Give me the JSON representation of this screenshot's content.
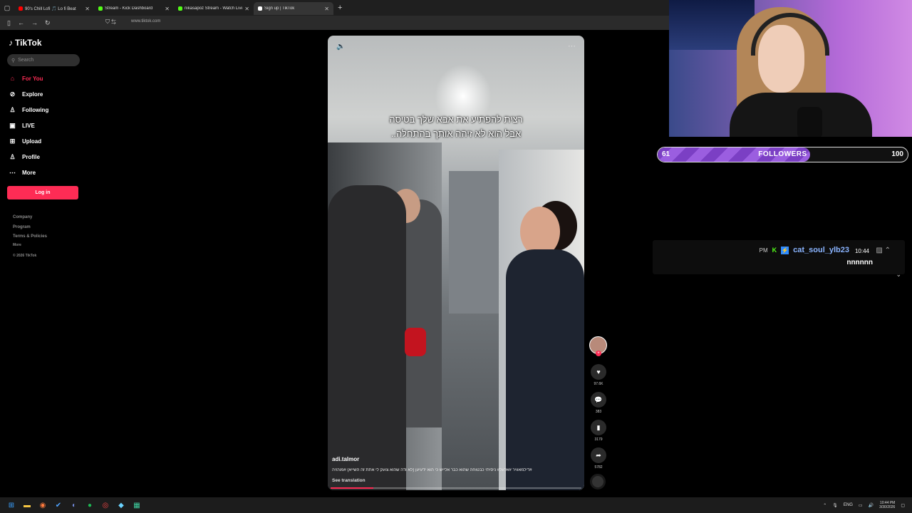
{
  "browser": {
    "tabs": [
      {
        "label": "90's Chill Lofi 🎵 Lo fi Beat",
        "color": "#ff0000"
      },
      {
        "label": "Stream - Kick Dashboard",
        "color": "#53fc18"
      },
      {
        "label": "nikasapoz Stream - Watch Live",
        "color": "#53fc18"
      },
      {
        "label": "Sign up | TikTok",
        "color": "#ffffff"
      }
    ],
    "new_tab": "+",
    "url": "www.tiktok.com"
  },
  "tiktok": {
    "logo": "TikTok",
    "search_placeholder": "Search",
    "nav": [
      {
        "label": "For You",
        "icon": "home-icon"
      },
      {
        "label": "Explore",
        "icon": "compass-icon"
      },
      {
        "label": "Following",
        "icon": "user-icon"
      },
      {
        "label": "LIVE",
        "icon": "live-icon"
      },
      {
        "label": "Upload",
        "icon": "plus-icon"
      },
      {
        "label": "Profile",
        "icon": "profile-icon"
      },
      {
        "label": "More",
        "icon": "dots-icon"
      }
    ],
    "login": "Log in",
    "footer": [
      "Company",
      "Program",
      "Terms & Policies",
      "More",
      "© 2026 TikTok"
    ],
    "video": {
      "caption_line1": "רצית להפתיע את אבא שלך בטיסה",
      "caption_line2": "אבל הוא לא זיהה אותך בהתחלה..",
      "author": "adi.talmor",
      "description": "#דילמאוויר #אלעל# ניסיתי כבטוחה שהוא כבר אלייש כי הוא ידעיען (לא ודה שהוא צועק לי אתת זה השייא) #מורגיה",
      "see_translation": "See translation",
      "progress": 0.17
    },
    "actions": [
      {
        "icon": "heart-icon",
        "count": "97.6K"
      },
      {
        "icon": "comment-icon",
        "count": "383"
      },
      {
        "icon": "bookmark-icon",
        "count": "3179"
      },
      {
        "icon": "share-icon",
        "count": "5782"
      }
    ]
  },
  "overlay": {
    "followers_current": "61",
    "followers_label": "FOLLOWERS",
    "followers_goal": "100",
    "followers_fraction": 0.61,
    "chat": {
      "pm": "PM",
      "username": "cat_soul_ylb23",
      "time": "10:44",
      "message": "nnnnnn"
    }
  },
  "taskbar": {
    "lang": "ENG",
    "time": "10:44 PM",
    "date": "3/30/2026"
  }
}
